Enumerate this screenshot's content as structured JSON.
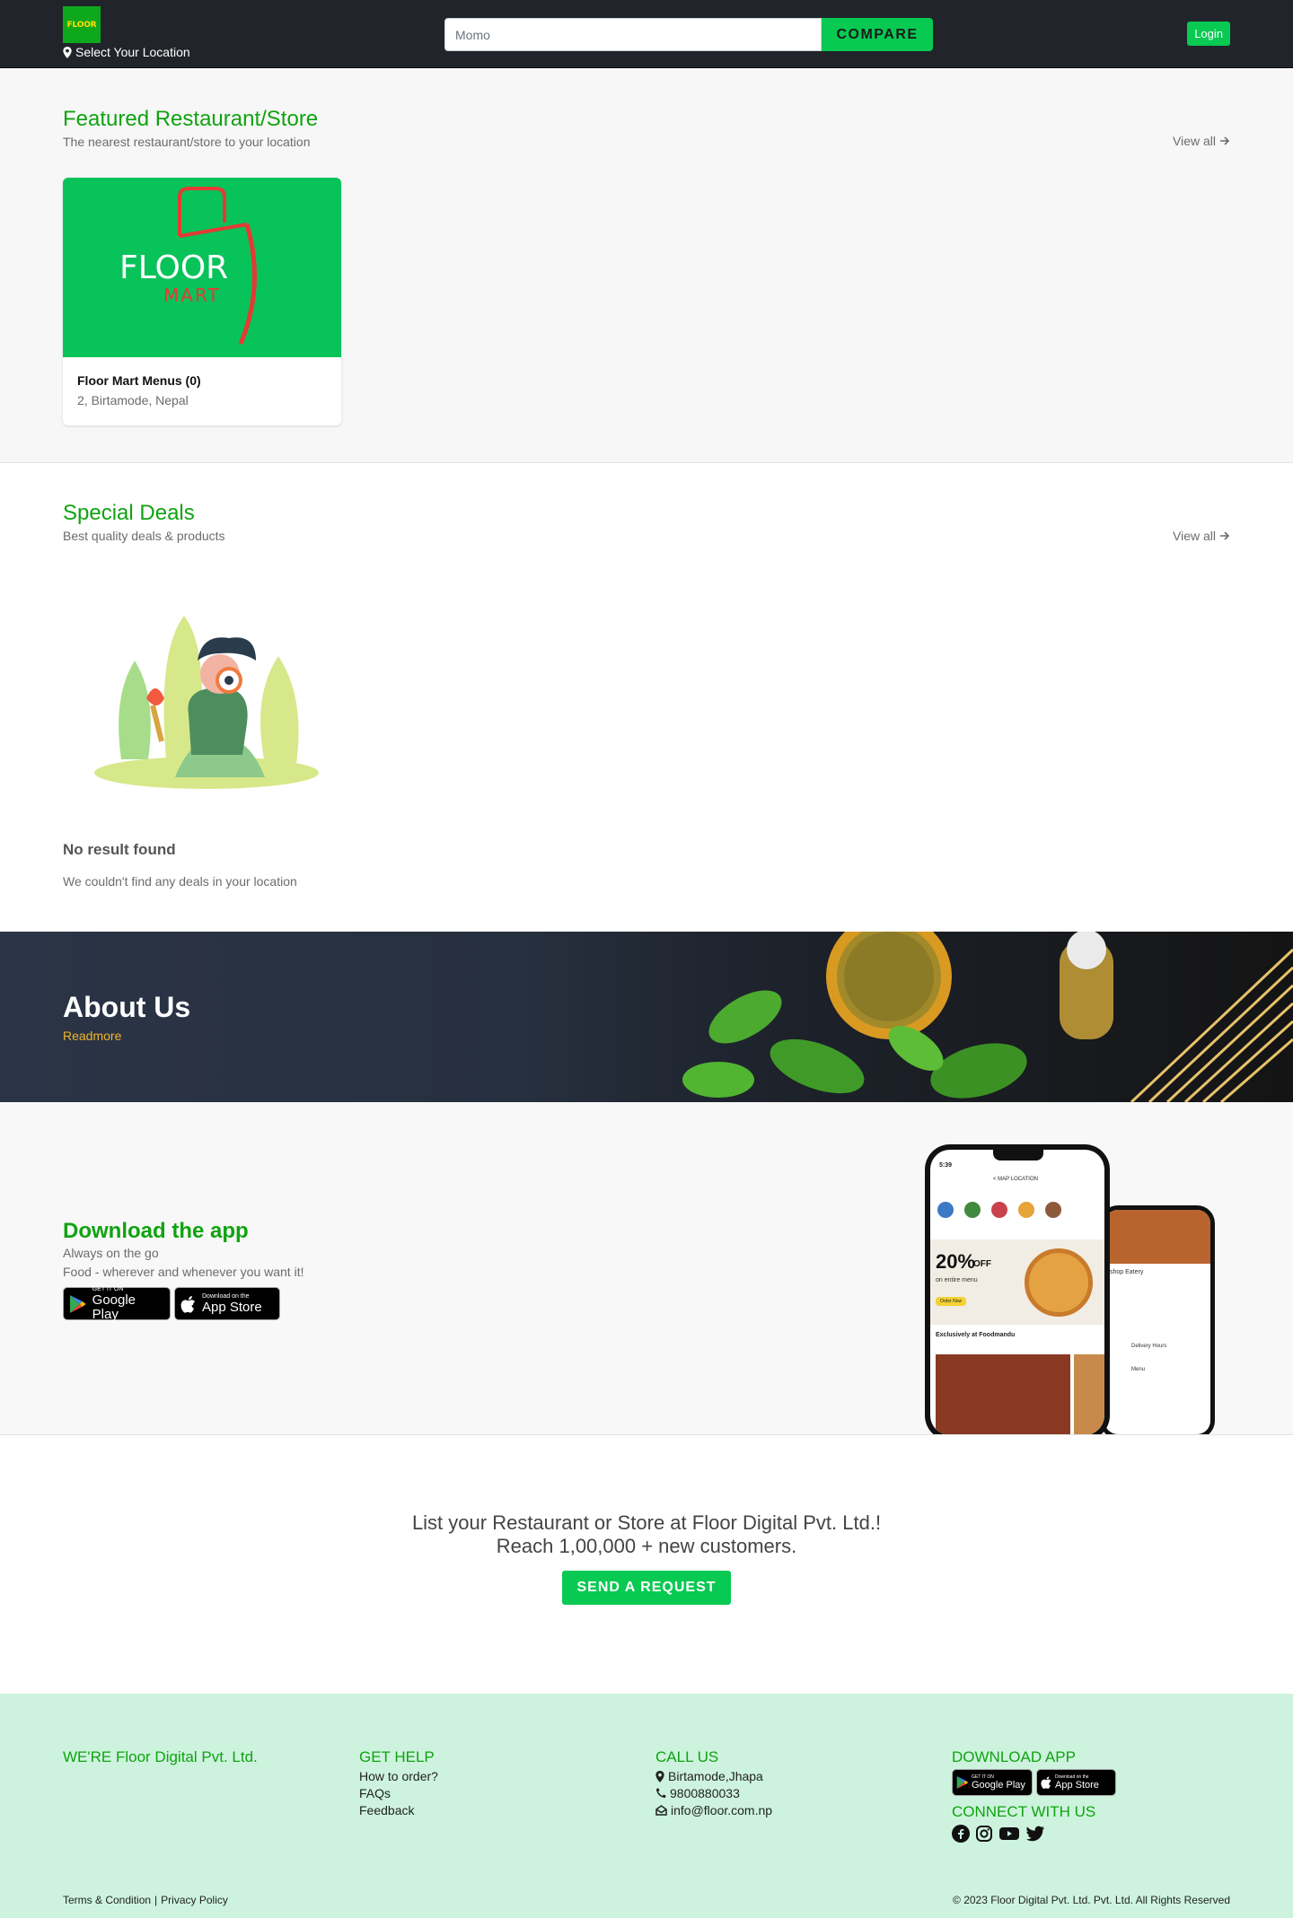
{
  "header": {
    "logo_text": "FLOOR",
    "location_label": "Select Your Location",
    "search_placeholder": "Momo",
    "compare_label": "COMPARE",
    "login_label": "Login"
  },
  "featured": {
    "title": "Featured Restaurant/Store",
    "subtitle": "The nearest restaurant/store to your location",
    "view_all": "View all",
    "card": {
      "brand_top": "FLOOR",
      "brand_bottom": "MART",
      "name": "Floor Mart Menus (0)",
      "address": "2, Birtamode, Nepal"
    }
  },
  "deals": {
    "title": "Special Deals",
    "subtitle": "Best quality deals & products",
    "view_all": "View all",
    "empty_title": "No result found",
    "empty_sub": "We couldn't find any deals in your location"
  },
  "about": {
    "title": "About Us",
    "readmore": "Readmore"
  },
  "download": {
    "title": "Download the app",
    "line1": "Always on the go",
    "line2": "Food - wherever and whenever you want it!",
    "google_small": "GET IT ON",
    "google_big": "Google Play",
    "apple_small": "Download on the",
    "apple_big": "App Store",
    "phone": {
      "time": "5:39",
      "map_label": "< MAP LOCATION",
      "promo_big": "20%",
      "promo_off": "OFF",
      "promo_sub": "on entire menu",
      "promo_btn": "Order Now",
      "exclusive": "Exclusively at Foodmandu",
      "eatery": "shop Eatery",
      "delivery": "Delivery Hours",
      "menu": "Menu"
    }
  },
  "cta": {
    "line1": "List your Restaurant or Store at Floor Digital Pvt. Ltd.!",
    "line2": "Reach 1,00,000 + new customers.",
    "button": "SEND A REQUEST"
  },
  "footer": {
    "about_head": "WE'RE Floor Digital Pvt. Ltd.",
    "help_head": "GET HELP",
    "help_links": [
      "How to order?",
      "FAQs",
      "Feedback"
    ],
    "call_head": "CALL US",
    "address": "Birtamode,Jhapa",
    "phone": "9800880033",
    "email": "info@floor.com.np",
    "download_head": "DOWNLOAD APP",
    "connect_head": "CONNECT WITH US",
    "terms": "Terms & Condition",
    "privacy": "Privacy Policy",
    "copyright": "© 2023 Floor Digital Pvt. Ltd. Pvt. Ltd. All Rights Reserved"
  },
  "colors": {
    "brand_green": "#10a310",
    "button_green": "#08c952",
    "header_bg": "#21252b",
    "footer_bg": "#cdf3de",
    "readmore": "#f0b429"
  }
}
